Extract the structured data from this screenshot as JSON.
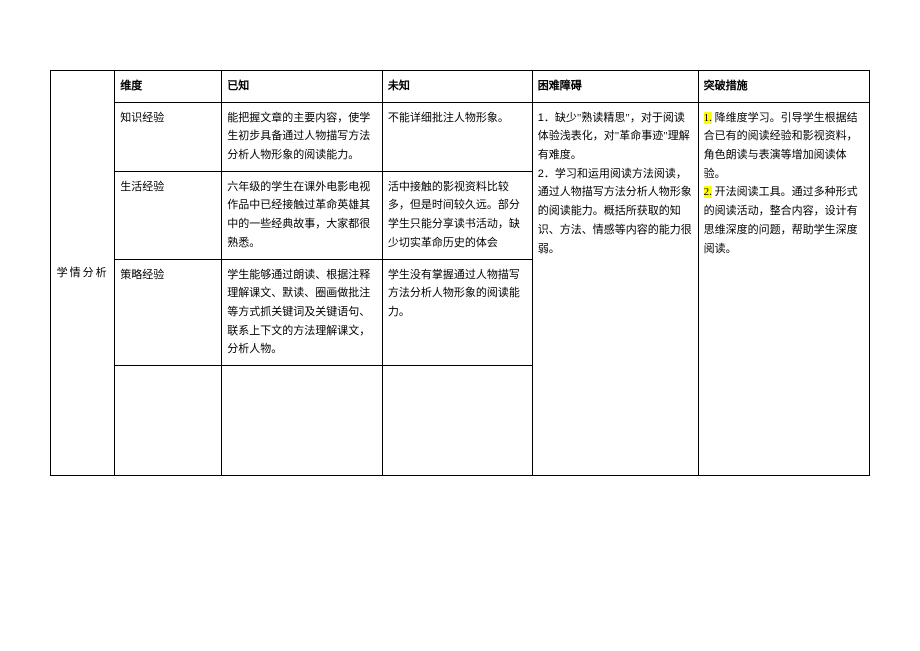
{
  "sideLabel": "学情分析",
  "headers": {
    "dimension": "维度",
    "known": "已知",
    "unknown": "未知",
    "barrier": "困难障碍",
    "measure": "突破措施"
  },
  "rows": {
    "knowledge": {
      "dimension": "知识经验",
      "known": "能把握文章的主要内容，使学生初步具备通过人物描写方法分析人物形象的阅读能力。",
      "unknown": "不能详细批注人物形象。"
    },
    "life": {
      "dimension": "生活经验",
      "known": "六年级的学生在课外电影电视作品中已经接触过革命英雄其中的一些经典故事，大家都很熟悉。",
      "unknown": "活中接触的影视资料比较多，但是时间较久远。部分学生只能分享读书活动，缺少切实革命历史的体会"
    },
    "strategy": {
      "dimension": "策略经验",
      "known": "学生能够通过朗读、根据注释理解课文、默读、圈画做批注等方式抓关键词及关键语句、联系上下文的方法理解课文，分析人物。",
      "unknown": "学生没有掌握通过人物描写方法分析人物形象的阅读能力。"
    }
  },
  "barrier": {
    "n1": "1",
    "p1a": "．缺少\"熟读精思\"，对于阅读体验浅表化，对\"革命事迹\"理解有难度。",
    "n2": "2",
    "p2a": "．学习和运用阅读方法阅读，通过人物描写方法分析人物形象的阅读能力。概括所获取的知识、方法、情感等内容的能力很弱。"
  },
  "measure": {
    "m1hl": "1.",
    "m1": " 降维度学习。引导学生根据结合已有的阅读经验和影视资料，角色朗读与表演等增加阅读体验。",
    "m2hl": "2.",
    "m2": " 开法阅读工具。通过多种形式的阅读活动，整合内容，设计有思维深度的问题，帮助学生深度阅读。"
  }
}
